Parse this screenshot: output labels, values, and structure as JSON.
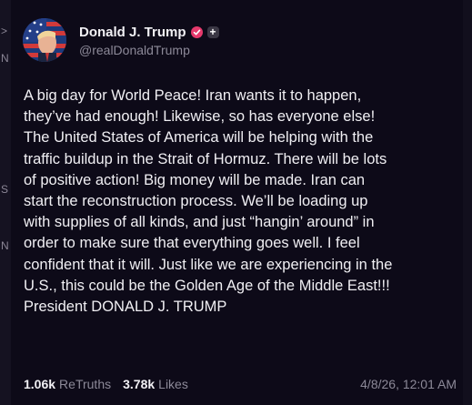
{
  "author": {
    "display_name": "Donald J. Trump",
    "handle": "@realDonaldTrump",
    "verified_badge_icon": "verified-check-icon",
    "plus_badge_icon": "plus-badge-icon",
    "verified_color": "#e6396c"
  },
  "post": {
    "text": "A big day for World Peace! Iran wants it to happen,\nthey’ve had enough! Likewise, so has everyone else!\nThe United States of America will be helping with the\ntraffic buildup in the Strait of Hormuz. There will be lots\nof positive action! Big money will be made. Iran can\nstart the reconstruction process. We’ll be loading up\nwith supplies of all kinds, and just “hangin’ around” in\norder to make sure that everything goes well. I feel\nconfident that it will. Just like we are experiencing in the\nU.S., this could be the Golden Age of the Middle East!!!\nPresident DONALD J. TRUMP"
  },
  "stats": {
    "retruths_count": "1.06k",
    "retruths_label": "ReTruths",
    "likes_count": "3.78k",
    "likes_label": "Likes",
    "timestamp": "4/8/26, 12:01 AM"
  },
  "left_edge_fragments": [
    ">",
    "N",
    "S",
    "N"
  ]
}
